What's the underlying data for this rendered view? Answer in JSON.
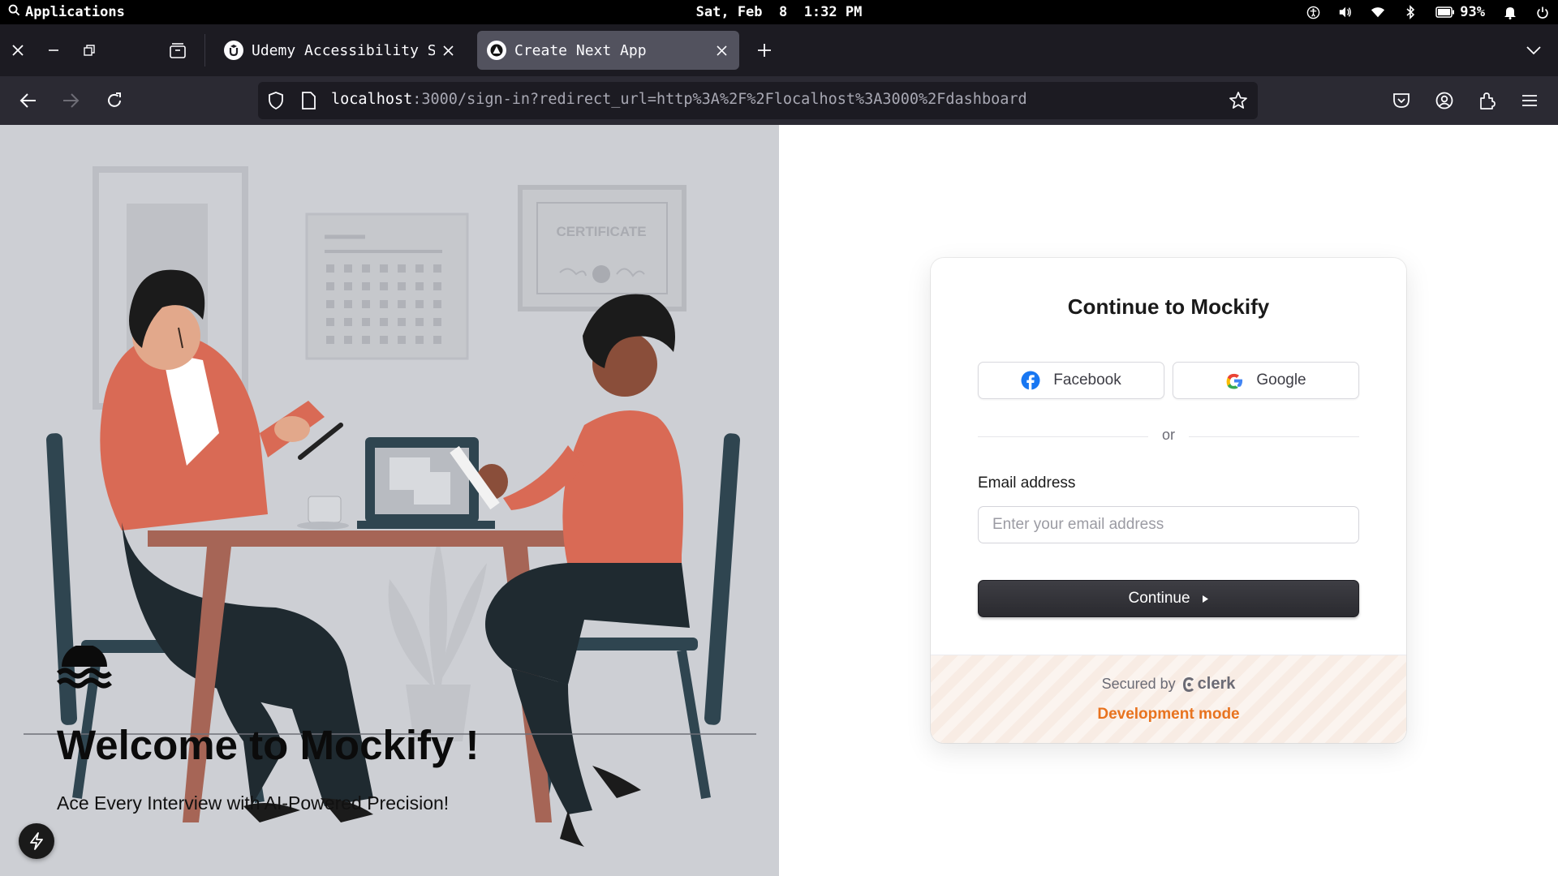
{
  "os_bar": {
    "app_menu": "Applications",
    "clock": "Sat, Feb  8  1:32 PM",
    "battery": "93%"
  },
  "browser": {
    "tabs": [
      {
        "title": "Udemy Accessibility Sta",
        "favicon": "udemy-icon",
        "active": false
      },
      {
        "title": "Create Next App",
        "favicon": "nextjs-icon",
        "active": true
      }
    ],
    "url": {
      "host": "localhost",
      "rest": ":3000/sign-in?redirect_url=http%3A%2F%2Flocalhost%3A3000%2Fdashboard"
    }
  },
  "hero": {
    "title": "Welcome to Mockify !",
    "tagline": "Ace Every Interview with AI-Powered Precision!",
    "certificate_text": "CERTIFICATE"
  },
  "signin": {
    "title": "Continue to Mockify",
    "facebook_label": "Facebook",
    "google_label": "Google",
    "divider": "or",
    "email_label": "Email address",
    "email_placeholder": "Enter your email address",
    "email_value": "",
    "continue_label": "Continue",
    "secured_by": "Secured by",
    "clerk_brand": "clerk",
    "dev_mode": "Development mode"
  },
  "colors": {
    "accent_orange": "#e8731f",
    "hero_bg": "#cdcfd4",
    "button_dark": "#2f2f34",
    "facebook_blue": "#1877f2"
  }
}
